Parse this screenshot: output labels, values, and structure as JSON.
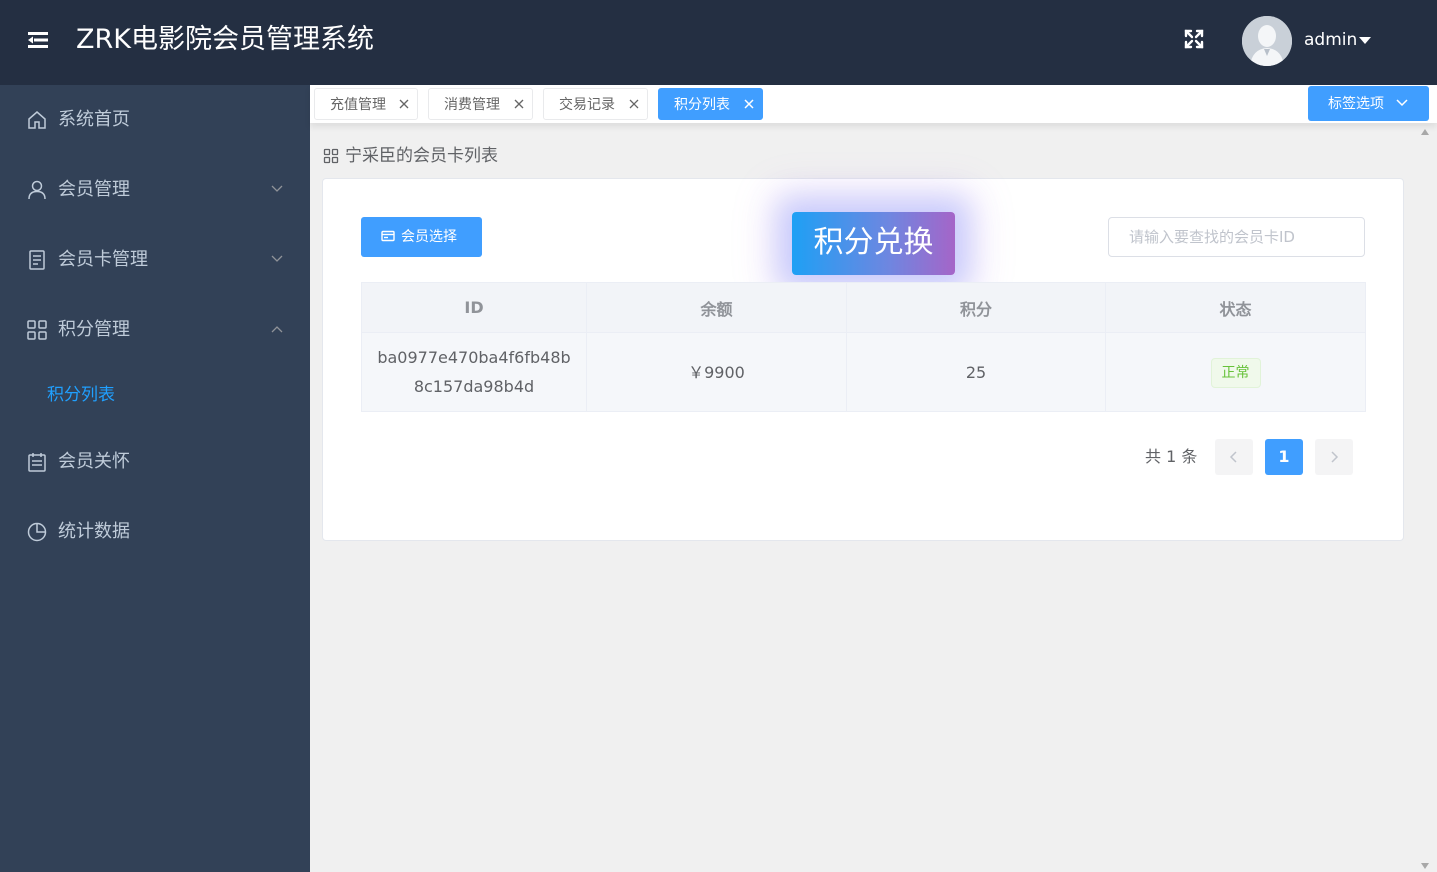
{
  "header": {
    "title": "ZRK电影院会员管理系统",
    "username": "admin",
    "menu_icon": "hamburger-icon",
    "fullscreen_icon": "fullscreen-icon"
  },
  "sidebar": {
    "items": [
      {
        "label": "系统首页",
        "icon": "home-icon"
      },
      {
        "label": "会员管理",
        "icon": "user-icon"
      },
      {
        "label": "会员卡管理",
        "icon": "document-icon"
      },
      {
        "label": "积分管理",
        "icon": "grid-icon",
        "expanded": true
      },
      {
        "label": "会员关怀",
        "icon": "calendar-icon"
      },
      {
        "label": "统计数据",
        "icon": "pie-chart-icon"
      }
    ],
    "submenu": [
      {
        "label": "积分列表",
        "active": true
      }
    ],
    "colors": {
      "bg": "#324157",
      "text": "#bfcbd9",
      "active": "#20a0ff"
    }
  },
  "tags": {
    "items": [
      {
        "label": "充值管理",
        "active": false
      },
      {
        "label": "消费管理",
        "active": false
      },
      {
        "label": "交易记录",
        "active": false
      },
      {
        "label": "积分列表",
        "active": true
      }
    ],
    "options_label": "标签选项"
  },
  "breadcrumb": {
    "text": "宁采臣的会员卡列表"
  },
  "toolbar": {
    "select_button": "会员选择",
    "exchange_button": "积分兑换",
    "search_placeholder": "请输入要查找的会员卡ID"
  },
  "table": {
    "columns": [
      "ID",
      "余额",
      "积分",
      "状态"
    ],
    "rows": [
      {
        "id": "ba0977e470ba4f6fb48b8c157da98b4d",
        "balance": "￥9900",
        "points": "25",
        "status": "正常"
      }
    ]
  },
  "pagination": {
    "total_text": "共 1 条",
    "current_page": "1"
  },
  "colors": {
    "primary": "#409eff",
    "header_bg": "#242f42",
    "success": "#67c23a"
  }
}
